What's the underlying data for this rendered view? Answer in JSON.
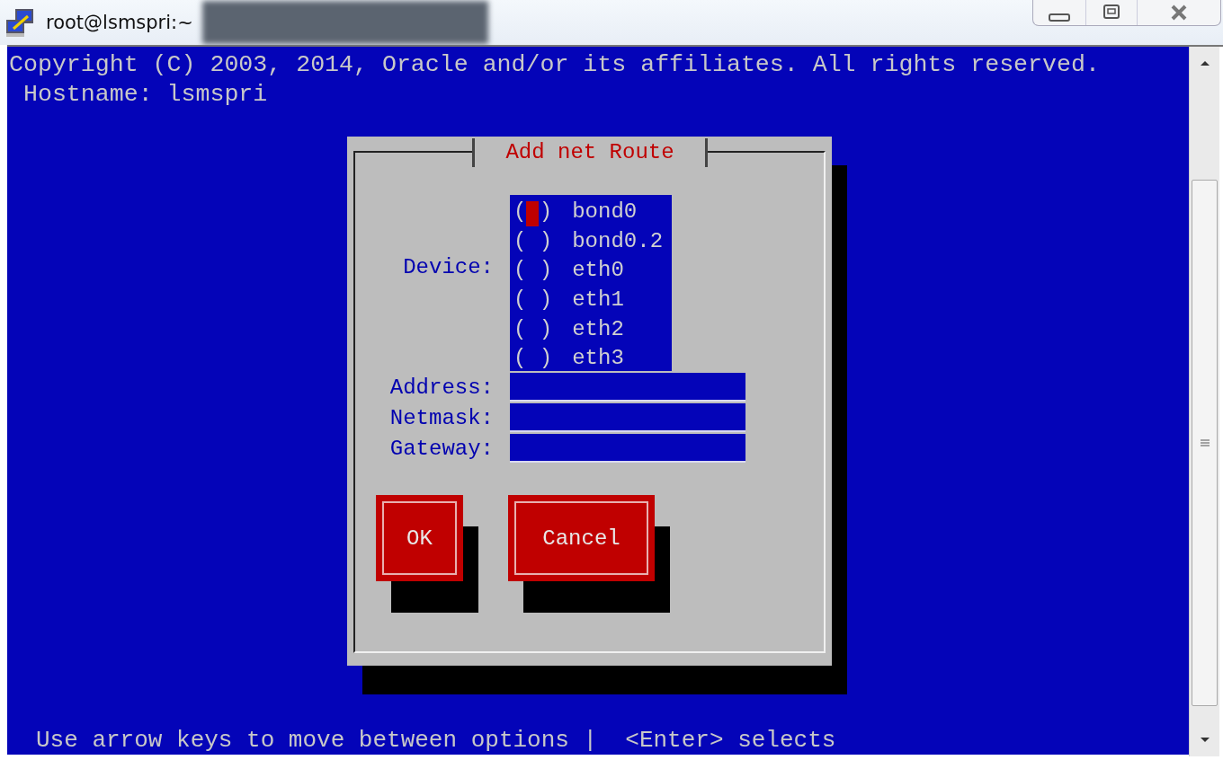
{
  "window": {
    "title": "root@lsmspri:~"
  },
  "terminal": {
    "lines": [
      "Copyright (C) 2003, 2014, Oracle and/or its affiliates. All rights reserved.",
      " Hostname: lsmspri"
    ],
    "status_line": "Use arrow keys to move between options |  <Enter> selects"
  },
  "dialog": {
    "title": "Add net Route",
    "device_label": "Device:",
    "devices": [
      {
        "box": "( )",
        "label": "bond0",
        "selected": false,
        "focused": true
      },
      {
        "box": "( )",
        "label": "bond0.2",
        "selected": false,
        "focused": false
      },
      {
        "box": "( )",
        "label": "eth0",
        "selected": false,
        "focused": false
      },
      {
        "box": "( )",
        "label": "eth1",
        "selected": false,
        "focused": false
      },
      {
        "box": "( )",
        "label": "eth2",
        "selected": false,
        "focused": false
      },
      {
        "box": "( )",
        "label": "eth3",
        "selected": false,
        "focused": false
      }
    ],
    "fields": [
      {
        "label": "Address:"
      },
      {
        "label": "Netmask:"
      },
      {
        "label": "Gateway:"
      }
    ],
    "buttons": [
      {
        "label": "OK",
        "kind": "ok"
      },
      {
        "label": "Cancel",
        "kind": "cancel"
      }
    ]
  }
}
